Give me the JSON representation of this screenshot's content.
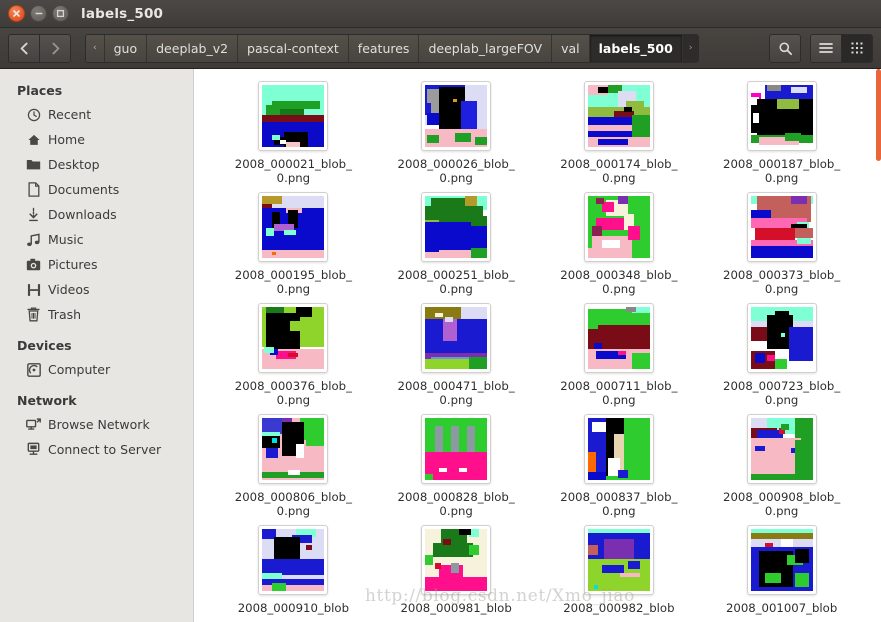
{
  "window": {
    "title": "labels_500",
    "buttons": {
      "close": "close",
      "minimize": "minimize",
      "maximize": "maximize"
    }
  },
  "toolbar": {
    "back_label": "Back",
    "forward_label": "Forward",
    "search_label": "Search",
    "menu_label": "Menu",
    "view_list_label": "List view",
    "view_grid_label": "Icon view",
    "breadcrumbs": [
      {
        "label": "‹",
        "active": false,
        "type": "root"
      },
      {
        "label": "guo",
        "active": false,
        "type": "dir"
      },
      {
        "label": "deeplab_v2",
        "active": false,
        "type": "dir"
      },
      {
        "label": "pascal-context",
        "active": false,
        "type": "dir"
      },
      {
        "label": "features",
        "active": false,
        "type": "dir"
      },
      {
        "label": "deeplab_largeFOV",
        "active": false,
        "type": "dir"
      },
      {
        "label": "val",
        "active": false,
        "type": "dir"
      },
      {
        "label": "labels_500",
        "active": true,
        "type": "dir"
      },
      {
        "label": "›",
        "active": false,
        "type": "tail"
      }
    ]
  },
  "sidebar": {
    "sections": [
      {
        "title": "Places",
        "items": [
          {
            "label": "Recent",
            "icon": "clock-icon"
          },
          {
            "label": "Home",
            "icon": "home-icon"
          },
          {
            "label": "Desktop",
            "icon": "folder-icon"
          },
          {
            "label": "Documents",
            "icon": "document-icon"
          },
          {
            "label": "Downloads",
            "icon": "download-icon"
          },
          {
            "label": "Music",
            "icon": "music-note-icon"
          },
          {
            "label": "Pictures",
            "icon": "camera-icon"
          },
          {
            "label": "Videos",
            "icon": "film-icon"
          },
          {
            "label": "Trash",
            "icon": "trash-icon"
          }
        ]
      },
      {
        "title": "Devices",
        "items": [
          {
            "label": "Computer",
            "icon": "computer-disk-icon"
          }
        ]
      },
      {
        "title": "Network",
        "items": [
          {
            "label": "Browse Network",
            "icon": "network-browse-icon"
          },
          {
            "label": "Connect to Server",
            "icon": "server-connect-icon"
          }
        ]
      }
    ]
  },
  "files": [
    {
      "name": "2008_000021_blob_0.png",
      "thumb": "t1"
    },
    {
      "name": "2008_000026_blob_0.png",
      "thumb": "t2"
    },
    {
      "name": "2008_000174_blob_0.png",
      "thumb": "t3"
    },
    {
      "name": "2008_000187_blob_0.png",
      "thumb": "t4"
    },
    {
      "name": "2008_000195_blob_0.png",
      "thumb": "t5"
    },
    {
      "name": "2008_000251_blob_0.png",
      "thumb": "t6"
    },
    {
      "name": "2008_000348_blob_0.png",
      "thumb": "t7"
    },
    {
      "name": "2008_000373_blob_0.png",
      "thumb": "t8"
    },
    {
      "name": "2008_000376_blob_0.png",
      "thumb": "t9"
    },
    {
      "name": "2008_000471_blob_0.png",
      "thumb": "t10"
    },
    {
      "name": "2008_000711_blob_0.png",
      "thumb": "t11"
    },
    {
      "name": "2008_000723_blob_0.png",
      "thumb": "t12"
    },
    {
      "name": "2008_000806_blob_0.png",
      "thumb": "t13"
    },
    {
      "name": "2008_000828_blob_0.png",
      "thumb": "t14"
    },
    {
      "name": "2008_000837_blob_0.png",
      "thumb": "t15"
    },
    {
      "name": "2008_000908_blob_0.png",
      "thumb": "t16"
    },
    {
      "name": "2008_000910_blob",
      "thumb": "t17"
    },
    {
      "name": "2008_000981_blob",
      "thumb": "t18"
    },
    {
      "name": "2008_000982_blob",
      "thumb": "t19"
    },
    {
      "name": "2008_001007_blob",
      "thumb": "t20"
    }
  ],
  "watermark": {
    "text": "http://blog.csdn.net/Xmo_jiao"
  },
  "colors": {
    "titlebar": "#413e3b",
    "toolbar": "#433f3c",
    "sidebar": "#e8e6e3",
    "close_button": "#e2562a",
    "scrollbar": "#e8663a",
    "crumb_active_bg": "#2e2c2a",
    "pane_background": "#ffffff"
  }
}
